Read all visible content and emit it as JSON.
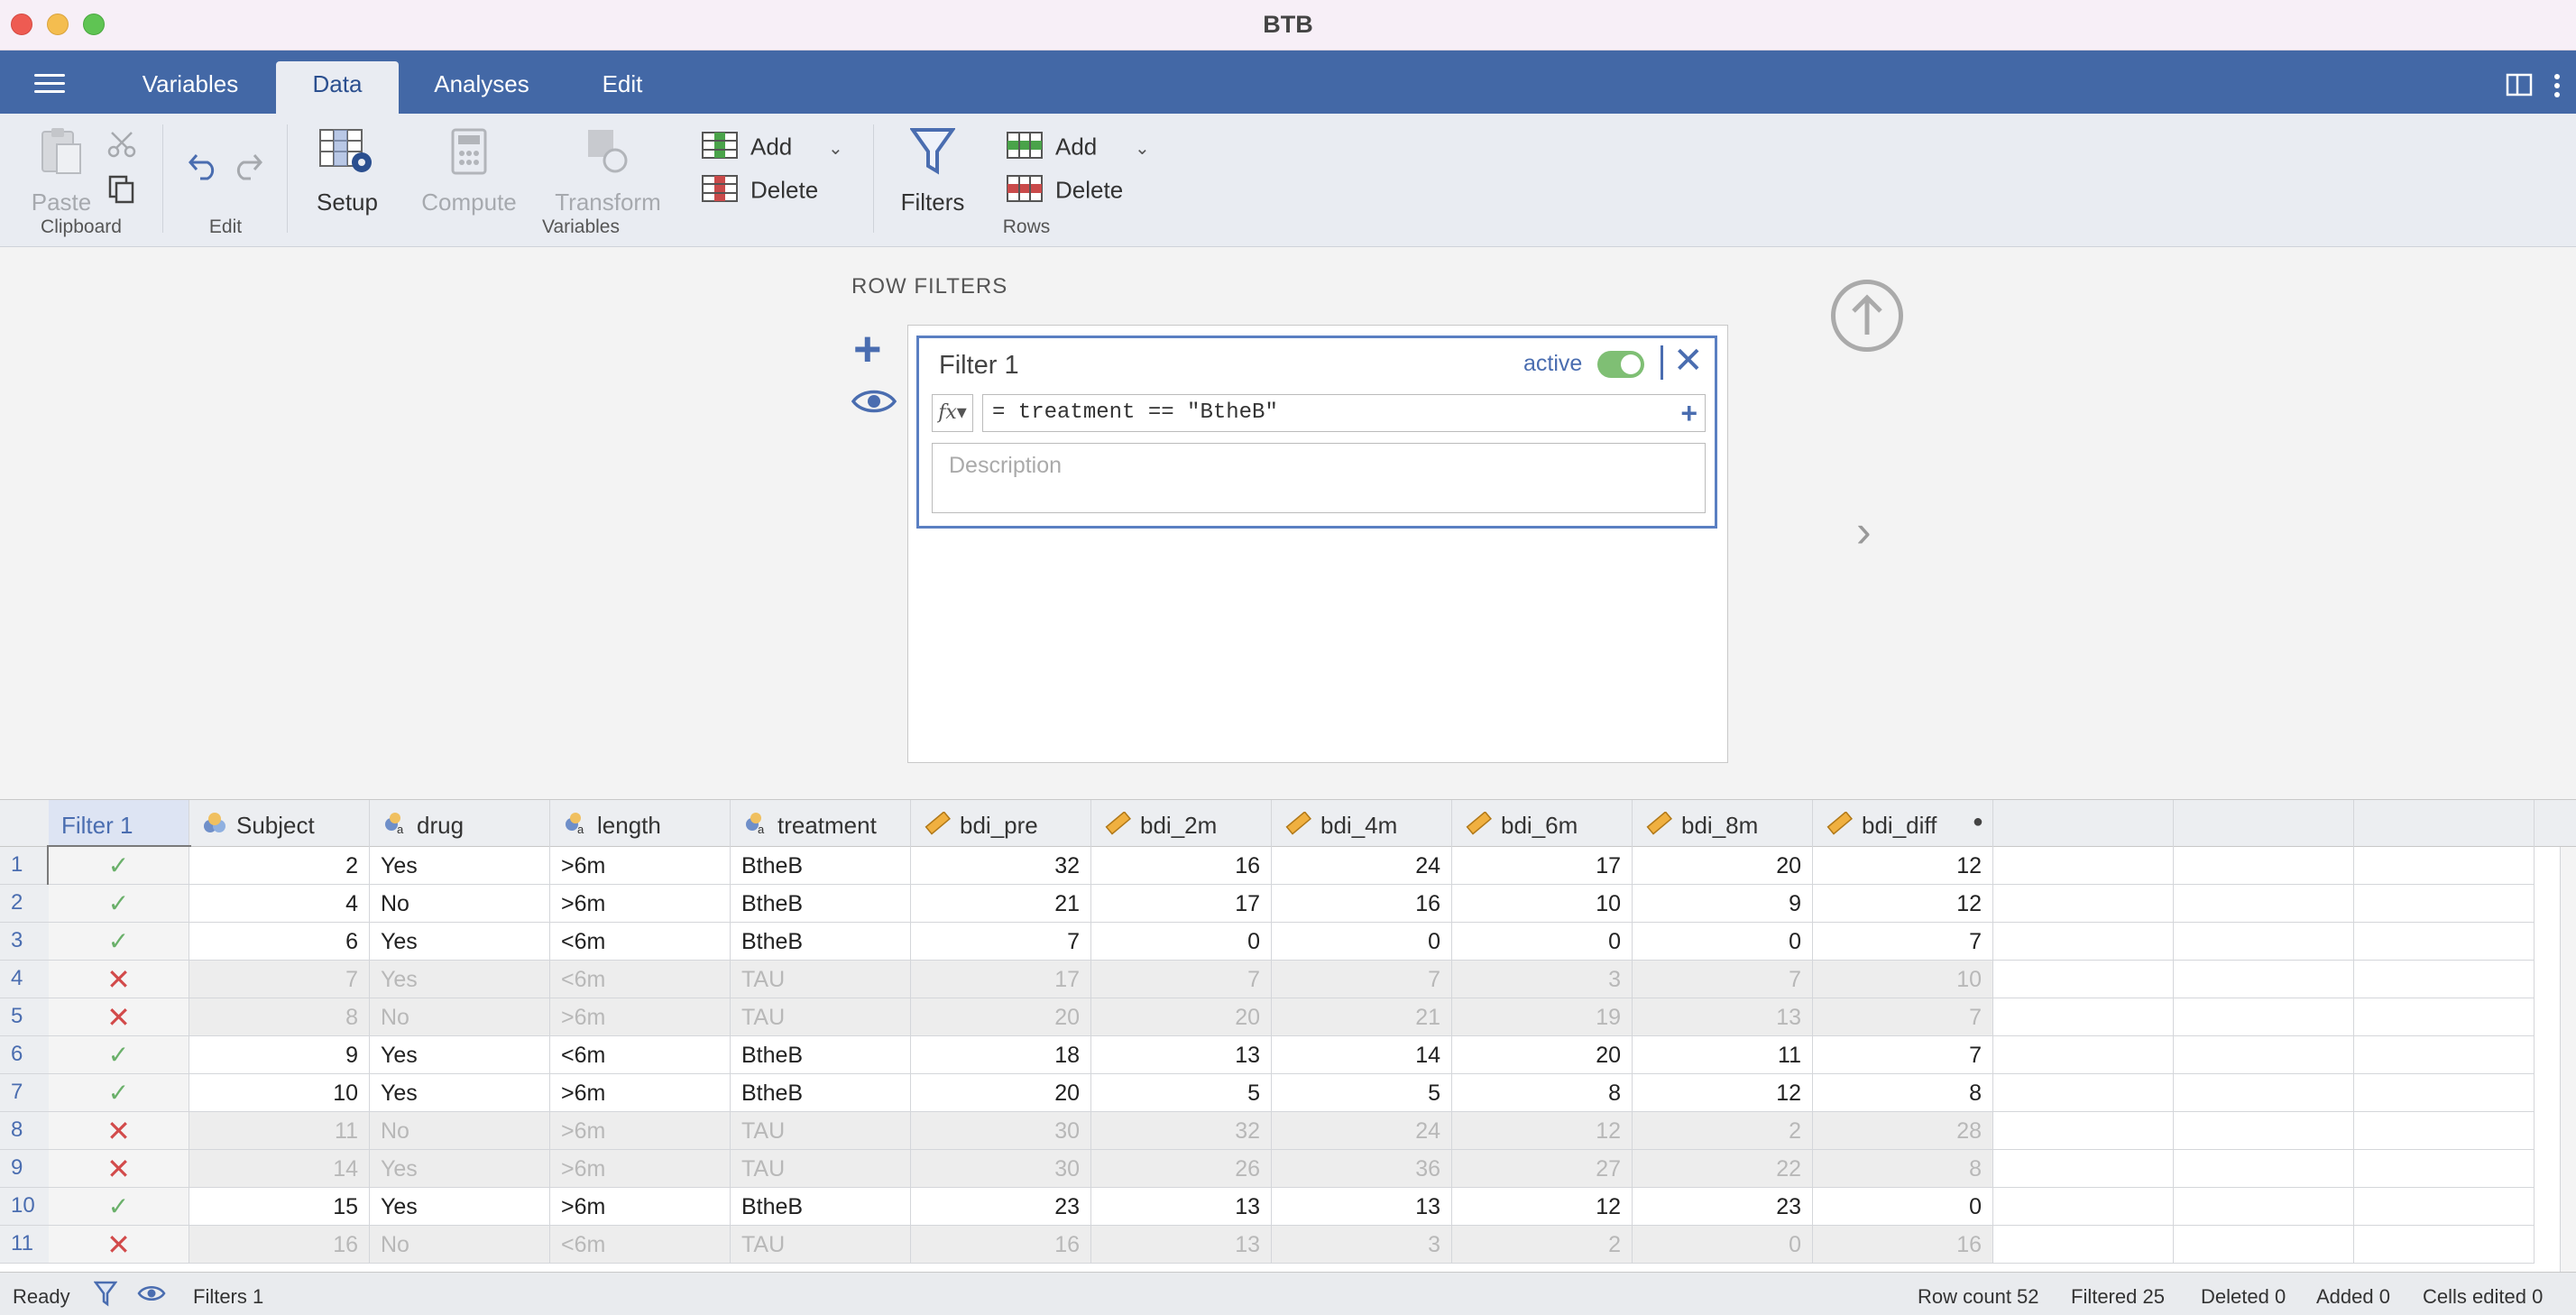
{
  "window": {
    "title": "BTB"
  },
  "tabs": [
    {
      "label": "Variables"
    },
    {
      "label": "Data"
    },
    {
      "label": "Analyses"
    },
    {
      "label": "Edit"
    }
  ],
  "ribbon": {
    "clipboard": {
      "paste": "Paste",
      "group": "Clipboard"
    },
    "edit": {
      "group": "Edit"
    },
    "variables": {
      "setup": "Setup",
      "compute": "Compute",
      "transform": "Transform",
      "add": "Add",
      "delete": "Delete",
      "group": "Variables"
    },
    "rows": {
      "filters": "Filters",
      "add": "Add",
      "delete": "Delete",
      "group": "Rows"
    }
  },
  "row_filters": {
    "heading": "ROW FILTERS",
    "filter": {
      "name": "Filter 1",
      "active_label": "active",
      "active": true,
      "formula": "= treatment == \"BtheB\"",
      "description_placeholder": "Description"
    }
  },
  "sheet": {
    "columns": [
      "Filter 1",
      "Subject",
      "drug",
      "length",
      "treatment",
      "bdi_pre",
      "bdi_2m",
      "bdi_4m",
      "bdi_6m",
      "bdi_8m",
      "bdi_diff"
    ],
    "rows": [
      {
        "n": "1",
        "pass": true,
        "cells": [
          "2",
          "Yes",
          ">6m",
          "BtheB",
          "32",
          "16",
          "24",
          "17",
          "20",
          "12"
        ]
      },
      {
        "n": "2",
        "pass": true,
        "cells": [
          "4",
          "No",
          ">6m",
          "BtheB",
          "21",
          "17",
          "16",
          "10",
          "9",
          "12"
        ]
      },
      {
        "n": "3",
        "pass": true,
        "cells": [
          "6",
          "Yes",
          "<6m",
          "BtheB",
          "7",
          "0",
          "0",
          "0",
          "0",
          "7"
        ]
      },
      {
        "n": "4",
        "pass": false,
        "cells": [
          "7",
          "Yes",
          "<6m",
          "TAU",
          "17",
          "7",
          "7",
          "3",
          "7",
          "10"
        ]
      },
      {
        "n": "5",
        "pass": false,
        "cells": [
          "8",
          "No",
          ">6m",
          "TAU",
          "20",
          "20",
          "21",
          "19",
          "13",
          "7"
        ]
      },
      {
        "n": "6",
        "pass": true,
        "cells": [
          "9",
          "Yes",
          "<6m",
          "BtheB",
          "18",
          "13",
          "14",
          "20",
          "11",
          "7"
        ]
      },
      {
        "n": "7",
        "pass": true,
        "cells": [
          "10",
          "Yes",
          ">6m",
          "BtheB",
          "20",
          "5",
          "5",
          "8",
          "12",
          "8"
        ]
      },
      {
        "n": "8",
        "pass": false,
        "cells": [
          "11",
          "No",
          ">6m",
          "TAU",
          "30",
          "32",
          "24",
          "12",
          "2",
          "28"
        ]
      },
      {
        "n": "9",
        "pass": false,
        "cells": [
          "14",
          "Yes",
          ">6m",
          "TAU",
          "30",
          "26",
          "36",
          "27",
          "22",
          "8"
        ]
      },
      {
        "n": "10",
        "pass": true,
        "cells": [
          "15",
          "Yes",
          ">6m",
          "BtheB",
          "23",
          "13",
          "13",
          "12",
          "23",
          "0"
        ]
      },
      {
        "n": "11",
        "pass": false,
        "cells": [
          "16",
          "No",
          "<6m",
          "TAU",
          "16",
          "13",
          "3",
          "2",
          "0",
          "16"
        ]
      }
    ]
  },
  "status": {
    "ready": "Ready",
    "filters": "Filters 1",
    "row_count": "Row count 52",
    "filtered": "Filtered 25",
    "deleted": "Deleted 0",
    "added": "Added 0",
    "cells_edited": "Cells edited 0"
  },
  "colors": {
    "accent": "#4368a6",
    "pass": "#6ab06a",
    "fail": "#d24a4a"
  }
}
